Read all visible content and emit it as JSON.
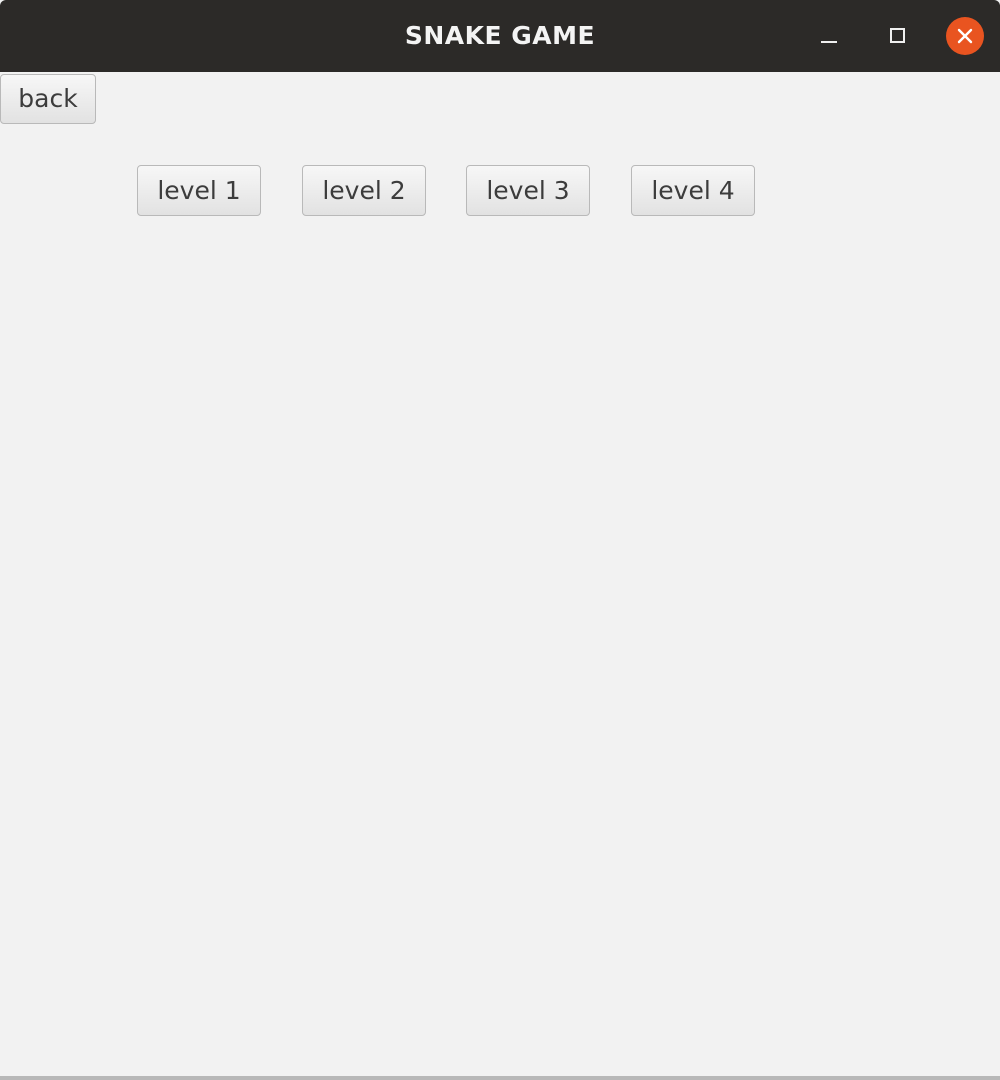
{
  "window": {
    "title": "SNAKE GAME",
    "controls": {
      "minimize": "minimize-icon",
      "maximize": "maximize-icon",
      "close": "close-icon"
    },
    "colors": {
      "titlebar": "#2c2a28",
      "close_accent": "#e95420",
      "background": "#f2f2f2"
    }
  },
  "toolbar": {
    "back_label": "back"
  },
  "levels": [
    {
      "label": "level 1"
    },
    {
      "label": "level 2"
    },
    {
      "label": "level 3"
    },
    {
      "label": "level 4"
    }
  ]
}
